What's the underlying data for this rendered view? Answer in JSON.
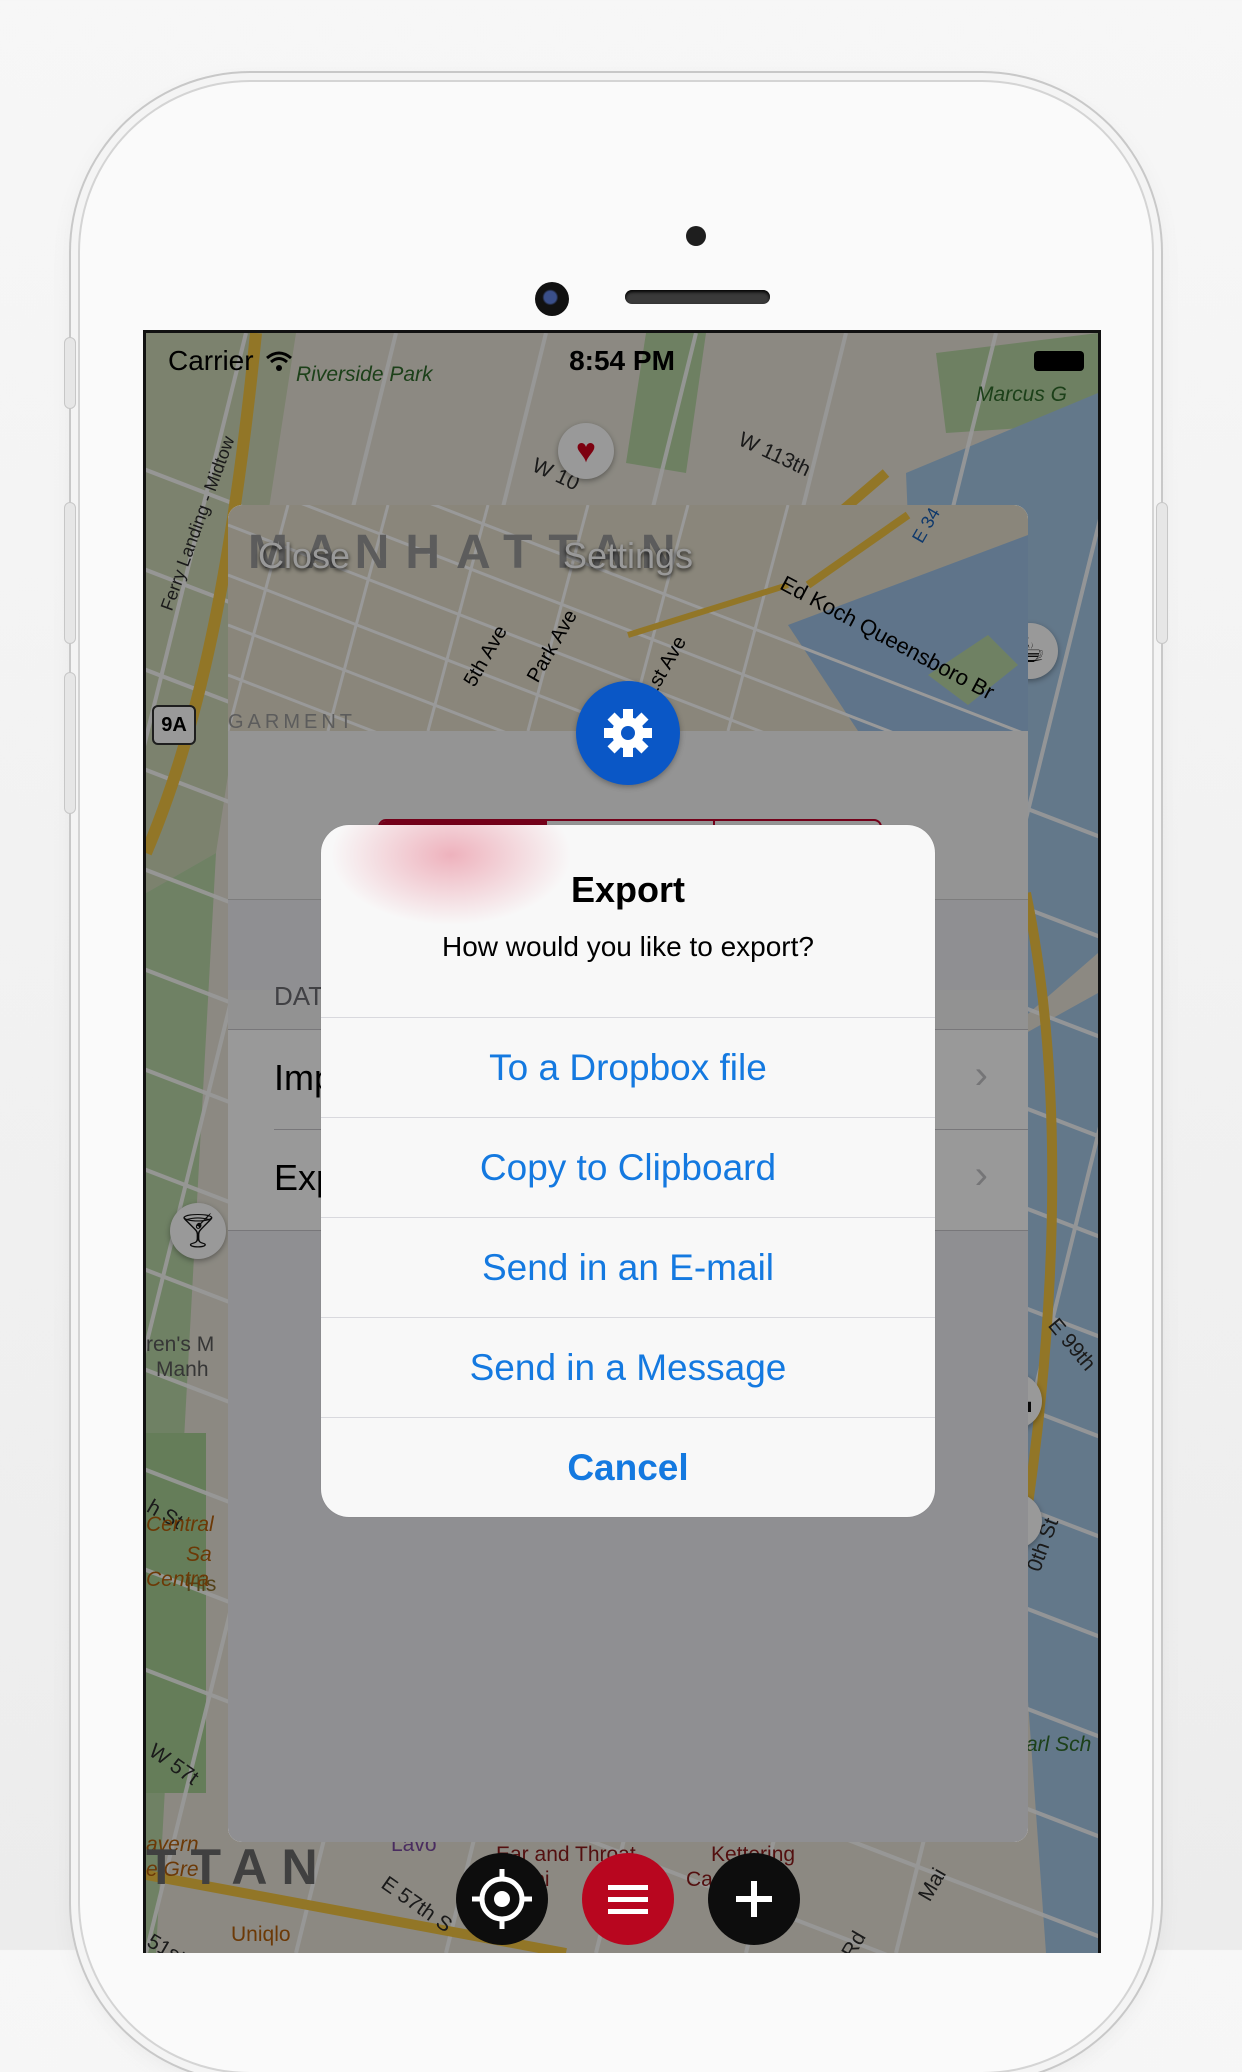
{
  "status_bar": {
    "carrier": "Carrier",
    "time": "8:54 PM"
  },
  "map": {
    "labels": {
      "riverside_park": "Riverside Park",
      "marcus": "Marcus G",
      "w113": "W 113th",
      "w108": "W 10",
      "ferry": "Ferry Landing - Midtow",
      "manhattan_top": "MANHATTAN",
      "garment": "GARMENT",
      "route_9a": "9A",
      "fifth_ave": "5th Ave",
      "park_ave": "Park Ave",
      "first_ave": "1st Ave",
      "ed_koch": "Ed Koch Queensboro Br",
      "e34": "E 34",
      "childrens": "ren's M",
      "manh": "Manh",
      "hist": "His",
      "th_st": "h St",
      "e99": "E 99th",
      "carl_sch": "arl Sch",
      "tavern": "avern",
      "the_green": "e Gre",
      "central": "Central",
      "sa": "Sa",
      "centra2": "Centra",
      "w57": "W 57t",
      "e57": "E 57th S",
      "ttan": "TTAN",
      "uniqlo": "Uniqlo",
      "ear_throat": "Ear and Throat",
      "hospital": "ospi",
      "kettering": "Kettering",
      "center": "Ca    nter",
      "mai": "Mai",
      "rd": "Rd",
      "th_st_right": "0th St",
      "st51": "51st",
      "lavo": "Lavo"
    }
  },
  "settings": {
    "close_label": "Close",
    "title": "Settings",
    "section_header": "DAT",
    "rows": [
      {
        "label": "Imp"
      },
      {
        "label": "Exp"
      }
    ]
  },
  "alert": {
    "title": "Export",
    "message": "How would you like to export?",
    "actions": [
      {
        "label": "To a Dropbox file"
      },
      {
        "label": "Copy to Clipboard"
      },
      {
        "label": "Send in an E-mail"
      },
      {
        "label": "Send in a Message"
      },
      {
        "label": "Cancel"
      }
    ]
  },
  "colors": {
    "accent_blue": "#1479e0",
    "segment_red": "#c0002a",
    "gear_blue": "#0a57c6",
    "toolbar_red": "#c0002a"
  },
  "icons": [
    "wifi-icon",
    "battery-icon",
    "gear-icon",
    "chevron-right-icon",
    "heart-icon",
    "coffee-icon",
    "bed-icon",
    "cocktail-icon",
    "restaurant-icon",
    "locate-icon",
    "menu-icon",
    "plus-icon"
  ]
}
